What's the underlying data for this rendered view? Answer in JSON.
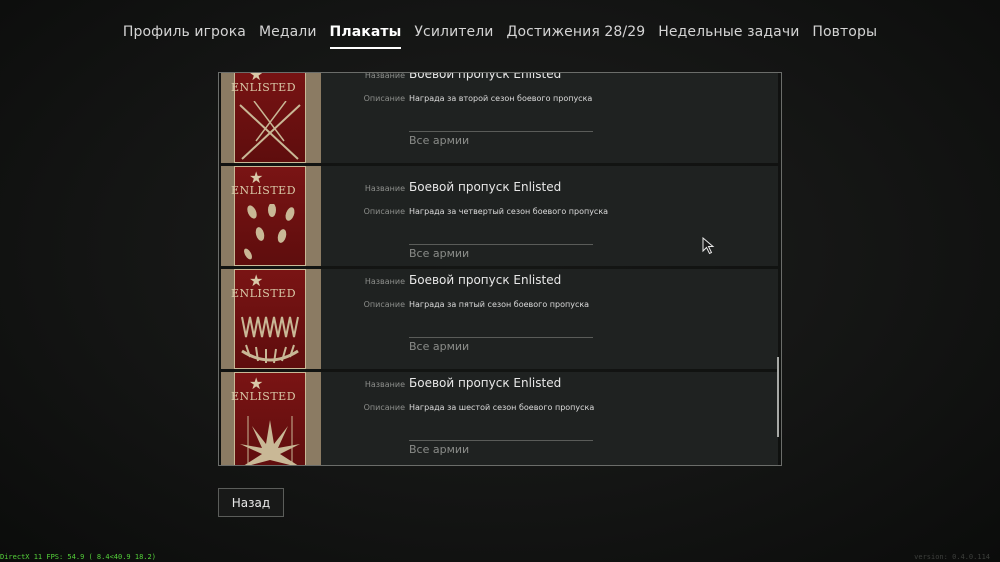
{
  "tabs": [
    {
      "label": "Профиль игрока"
    },
    {
      "label": "Медали"
    },
    {
      "label": "Плакаты",
      "active": true
    },
    {
      "label": "Усилители"
    },
    {
      "label": "Достижения 28/29"
    },
    {
      "label": "Недельные задачи"
    },
    {
      "label": "Повторы"
    }
  ],
  "field_labels": {
    "name": "Название",
    "description": "Описание"
  },
  "posters": [
    {
      "logo": "ENLISTED",
      "name": "Боевой пропуск Enlisted",
      "description": "Награда за второй сезон боевого пропуска",
      "armies": "Все армии"
    },
    {
      "logo": "ENLISTED",
      "name": "Боевой пропуск Enlisted",
      "description": "Награда за четвертый сезон боевого пропуска",
      "armies": "Все армии"
    },
    {
      "logo": "ENLISTED",
      "name": "Боевой пропуск Enlisted",
      "description": "Награда за пятый сезон боевого пропуска",
      "armies": "Все армии"
    },
    {
      "logo": "ENLISTED",
      "name": "Боевой пропуск Enlisted",
      "description": "Награда за шестой сезон боевого пропуска",
      "armies": "Все армии"
    }
  ],
  "back_button": "Назад",
  "fps_overlay": "DirectX 11 FPS: 54.9 ( 8.4<40.9 18.2)",
  "version": "version: 0.4.0.114",
  "colors": {
    "poster_red": "#7a1414",
    "fps_green": "#54d13a"
  }
}
